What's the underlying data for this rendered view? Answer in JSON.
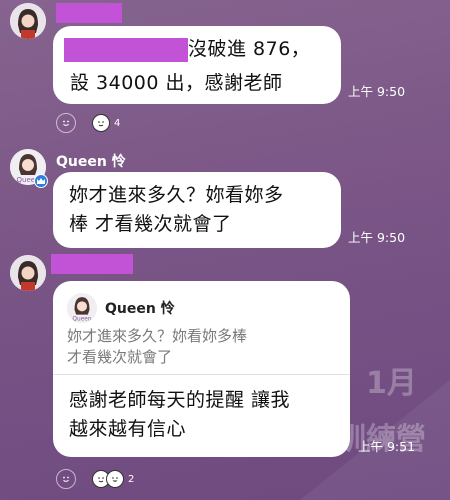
{
  "watermark": {
    "month": "1月",
    "camp": "訓練營"
  },
  "messages": [
    {
      "text_line1": "沒破進 876，",
      "text_line2": "設 34000 出，感謝老師",
      "time": "上午 9:50",
      "reaction_count": "4"
    },
    {
      "sender": "Queen 怜",
      "text_line1": "妳才進來多久？妳看妳多",
      "text_line2": "棒 才看幾次就會了",
      "time": "上午 9:50"
    },
    {
      "quote_sender": "Queen 怜",
      "quote_line1": "妳才進來多久？妳看妳多棒",
      "quote_line2": "才看幾次就會了",
      "text_line1": "感謝老師每天的提醒  讓我",
      "text_line2": "越來越有信心",
      "time": "上午 9:51",
      "reaction_count": "2"
    }
  ],
  "colors": {
    "redaction": "#c253d6",
    "bubble": "#ffffff",
    "background": "#7a5586"
  }
}
